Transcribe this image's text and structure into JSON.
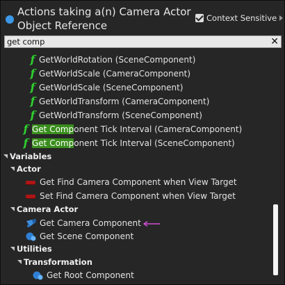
{
  "header": {
    "title": "Actions taking a(n) Camera Actor Object Reference",
    "context_sensitive": "Context Sensitive"
  },
  "search": {
    "value": "get comp"
  },
  "function_rows": [
    "GetWorldRotation (SceneComponent)",
    "GetWorldScale (CameraComponent)",
    "GetWorldScale (SceneComponent)",
    "GetWorldTransform (CameraComponent)",
    "GetWorldTransform (SceneComponent)"
  ],
  "tick_rows": [
    {
      "match": "Get Comp",
      "rest": "onent Tick Interval (CameraComponent)"
    },
    {
      "match": "Get Comp",
      "rest": "onent Tick Interval (SceneComponent)"
    }
  ],
  "categories": {
    "variables": "Variables",
    "actor": "Actor",
    "camera_actor": "Camera Actor",
    "utilities": "Utilities",
    "transformation": "Transformation"
  },
  "actor_items": [
    "Get Find Camera Component when View Target",
    "Set Find Camera Component when View Target"
  ],
  "camera_actor_items": [
    "Get Camera Component",
    "Get Scene Component"
  ],
  "transformation_items": [
    "Get Root Component"
  ],
  "colors": {
    "accent": "#3d98e8",
    "function_icon": "#2fd02f",
    "highlight": "#3a8e1d",
    "pointer_arrow": "#d24fd6"
  }
}
